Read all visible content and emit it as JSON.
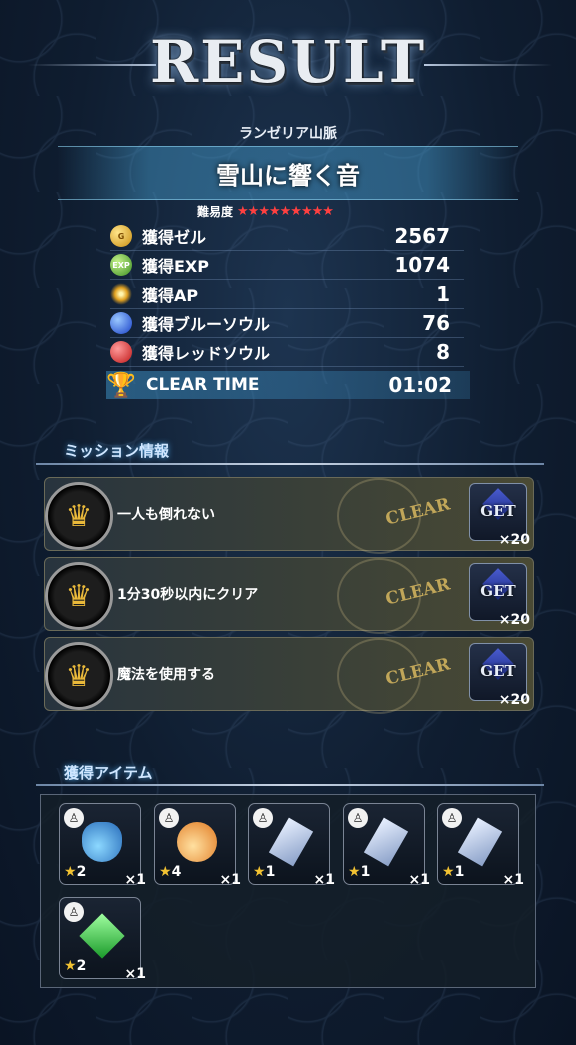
{
  "header": {
    "title": "RESULT"
  },
  "quest": {
    "region": "ランゼリア山脈",
    "name": "雪山に響く音",
    "difficulty_label": "難易度",
    "difficulty_stars": "★★★★★★★★★"
  },
  "stats": [
    {
      "label": "獲得ゼル",
      "value": "2567",
      "icon": "gil-coin-icon"
    },
    {
      "label": "獲得EXP",
      "value": "1074",
      "icon": "exp-icon"
    },
    {
      "label": "獲得AP",
      "value": "1",
      "icon": "ap-icon"
    },
    {
      "label": "獲得ブルーソウル",
      "value": "76",
      "icon": "blue-soul-icon"
    },
    {
      "label": "獲得レッドソウル",
      "value": "8",
      "icon": "red-soul-icon"
    }
  ],
  "clear_time": {
    "label": "CLEAR TIME",
    "value": "01:02"
  },
  "missions": {
    "section_title": "ミッション情報",
    "items": [
      {
        "label": "一人も倒れない",
        "status": "CLEAR",
        "reward_label": "GET",
        "reward_count": "×20"
      },
      {
        "label": "1分30秒以内にクリア",
        "status": "CLEAR",
        "reward_label": "GET",
        "reward_count": "×20"
      },
      {
        "label": "魔法を使用する",
        "status": "CLEAR",
        "reward_label": "GET",
        "reward_count": "×20"
      }
    ]
  },
  "items": {
    "section_title": "獲得アイテム",
    "list": [
      {
        "icon": "blue-potion-icon",
        "rarity": "2",
        "qty": "×1"
      },
      {
        "icon": "orange-potion-icon",
        "rarity": "4",
        "qty": "×1"
      },
      {
        "icon": "crystal-icon",
        "rarity": "1",
        "qty": "×1"
      },
      {
        "icon": "crystal-icon",
        "rarity": "1",
        "qty": "×1"
      },
      {
        "icon": "crystal-icon",
        "rarity": "1",
        "qty": "×1"
      },
      {
        "icon": "emerald-icon",
        "rarity": "2",
        "qty": "×1"
      }
    ]
  },
  "colors": {
    "accent": "#4aa0e0",
    "star_red": "#ff4040",
    "gold": "#f2c232"
  }
}
